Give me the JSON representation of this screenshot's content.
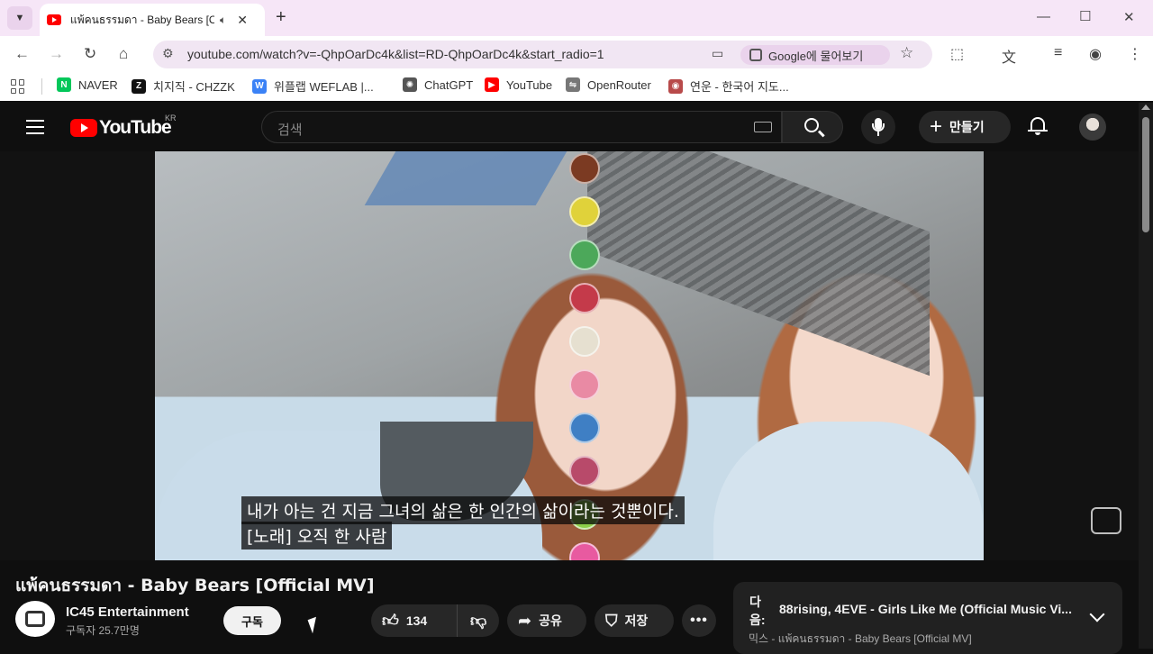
{
  "browser": {
    "tab_title": "แพ้คนธรรมดา - Baby Bears [Official MV] - YouTube",
    "url": "youtube.com/watch?v=-QhpOarDc4k&list=RD-QhpOarDc4k&start_radio=1",
    "google_ask": "Google에 물어보기",
    "bookmarks": [
      {
        "label": "NAVER",
        "color": "#03c75a",
        "icon": "N"
      },
      {
        "label": "치지직 - CHZZK",
        "color": "#111111",
        "icon": "Z"
      },
      {
        "label": "위플랩 WEFLAB |...",
        "color": "#3b82f6",
        "icon": "W"
      },
      {
        "label": "ChatGPT",
        "color": "#555555",
        "icon": "✺"
      },
      {
        "label": "YouTube",
        "color": "#ff0000",
        "icon": "▶"
      },
      {
        "label": "OpenRouter",
        "color": "#777777",
        "icon": "⇋"
      },
      {
        "label": "연운 - 한국어 지도...",
        "color": "#b84a4a",
        "icon": "◉"
      }
    ]
  },
  "youtube": {
    "logo_text": "YouTube",
    "region": "KR",
    "search_placeholder": "검색",
    "create_label": "만들기"
  },
  "player": {
    "caption_line1": "내가 아는 건 지금 그녀의 삶은 한 인간의 삶이라는 것뿐이다.",
    "caption_line2": "[노래] 오직 한 사람"
  },
  "video": {
    "title": "แพ้คนธรรมดา - Baby Bears [Official MV]",
    "channel": "IC45 Entertainment",
    "subscribers": "구독자 25.7만명",
    "subscribe_label": "구독",
    "likes": "134",
    "share_label": "공유",
    "save_label": "저장"
  },
  "up_next": {
    "label": "다음:",
    "title": "88rising, 4EVE - Girls Like Me (Official Music Vi...",
    "mix": "믹스 - แพ้คนธรรมดา - Baby Bears [Official MV]"
  }
}
